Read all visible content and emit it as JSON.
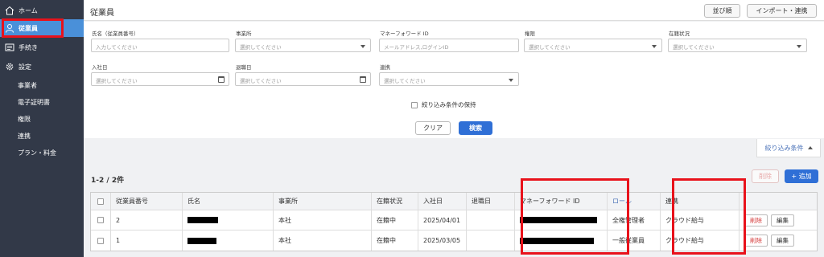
{
  "sidebar": {
    "items": [
      {
        "label": "ホーム",
        "icon": "home-icon"
      },
      {
        "label": "従業員",
        "icon": "person-icon",
        "active": true
      },
      {
        "label": "手続き",
        "icon": "list-icon"
      },
      {
        "label": "設定",
        "icon": "gear-icon"
      }
    ],
    "settings_sub": [
      "事業者",
      "電子証明書",
      "権限",
      "連携",
      "プラン・料金"
    ]
  },
  "header": {
    "title": "従業員",
    "sort_label": "並び順",
    "import_label": "インポート・連携"
  },
  "filters": {
    "name_label": "氏名（従業員番号）",
    "name_placeholder": "入力してください",
    "office_label": "事業所",
    "office_placeholder": "選択してください",
    "mf_id_label": "マネーフォワード ID",
    "mf_id_placeholder": "メールアドレス,ログインID",
    "role_label": "権限",
    "role_placeholder": "選択してください",
    "status_label": "在籍状況",
    "status_placeholder": "選択してください",
    "join_label": "入社日",
    "join_placeholder": "選択してください",
    "leave_label": "退職日",
    "leave_placeholder": "選択してください",
    "link_label": "連携",
    "link_placeholder": "選択してください",
    "keep_label": "絞り込み条件の保持",
    "clear_label": "クリア",
    "search_label": "検索"
  },
  "results": {
    "filter_tab": "絞り込み条件",
    "count": "1-2 / 2件",
    "delete_label": "削除",
    "add_label": "+ 追加",
    "columns": [
      "従業員番号",
      "氏名",
      "事業所",
      "在籍状況",
      "入社日",
      "退職日",
      "マネーフォワード ID",
      "ロール",
      "連携"
    ],
    "rows": [
      {
        "number": "2",
        "office": "本社",
        "status": "在籍中",
        "join_date": "2025/04/01",
        "leave_date": "",
        "role": "全権管理者",
        "link": "クラウド給与"
      },
      {
        "number": "1",
        "office": "本社",
        "status": "在籍中",
        "join_date": "2025/03/05",
        "leave_date": "",
        "role": "一般従業員",
        "link": "クラウド給与"
      }
    ],
    "row_delete": "削除",
    "row_edit": "編集"
  },
  "colors": {
    "sidebar_bg": "#323948",
    "active_bg": "#4a90d9",
    "primary": "#2f6fd6",
    "highlight": "#e8121b",
    "delete_text": "#d43b3b"
  }
}
